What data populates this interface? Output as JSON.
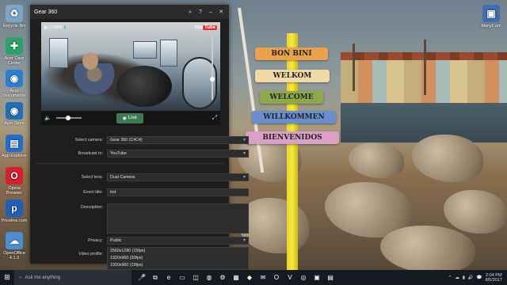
{
  "desktop": {
    "icons_left": [
      {
        "label": "Recycle Bin",
        "icon": "recycle-bin-icon",
        "color": "#7aa7c7",
        "glyph": "♻"
      },
      {
        "label": "Acer Care Center",
        "icon": "acer-care-center-icon",
        "color": "#2aa36a",
        "glyph": "✚"
      },
      {
        "label": "Acer Documents",
        "icon": "acer-documents-icon",
        "color": "#2a7fd0",
        "glyph": "◉"
      },
      {
        "label": "Acer Store",
        "icon": "acer-store-icon",
        "color": "#1e6fb8",
        "glyph": "◉"
      },
      {
        "label": "App Explorer",
        "icon": "app-explorer-icon",
        "color": "#1f6fd0",
        "glyph": "▤"
      },
      {
        "label": "Opera Browser",
        "icon": "opera-icon",
        "color": "#d6202e",
        "glyph": "O"
      },
      {
        "label": "Priceline.com",
        "icon": "priceline-icon",
        "color": "#1f5fb6",
        "glyph": "p"
      },
      {
        "label": "OpenOffice 4.1.3",
        "icon": "openoffice-icon",
        "color": "#4a8fd6",
        "glyph": "☁"
      }
    ],
    "icon_right": {
      "label": "ManyCam",
      "icon": "manycam-icon",
      "color": "#3e6fae",
      "glyph": "▣"
    },
    "signs": [
      "BON BINI",
      "WELKOM",
      "WELCOME",
      "WILLKOMMEN",
      "BIENVENIDOS"
    ]
  },
  "app": {
    "title": "Gear 360",
    "titlebar_buttons": [
      "●",
      "?",
      "–",
      "✕"
    ],
    "video": {
      "status_left": "100%",
      "youtube_label": "You",
      "youtube_badge": "Tube"
    },
    "controls": {
      "live_label": "Live",
      "volume_icon": "🔈",
      "fullscreen_icon": "⤢"
    },
    "form": {
      "camera_label": "Select camera:",
      "camera_value": "Gear 360 (C4C4)",
      "broadcast_label": "Broadcast to:",
      "broadcast_value": "YouTube",
      "lens_label": "Select lens:",
      "lens_value": "Dual Camera",
      "event_title_label": "Event title:",
      "event_title_value": "trst",
      "description_label": "Description:",
      "description_value": "",
      "privacy_label": "Privacy:",
      "privacy_value": "Public",
      "video_profile_label": "Video profile:",
      "video_profiles": [
        "2560x1280 (15fps)",
        "1920x960 (30fps)",
        "1920x960 (15fps)"
      ]
    }
  },
  "taskbar": {
    "search_placeholder": "Ask me anything",
    "apps": [
      {
        "icon": "microphone-icon",
        "glyph": "🎤"
      },
      {
        "icon": "task-view-icon",
        "glyph": "⧉"
      },
      {
        "icon": "edge-icon",
        "glyph": "e"
      },
      {
        "icon": "file-explorer-icon",
        "glyph": "▭"
      },
      {
        "icon": "store-icon",
        "glyph": "◫"
      },
      {
        "icon": "chrome-icon",
        "glyph": "◍"
      },
      {
        "icon": "settings-icon",
        "glyph": "⚙"
      },
      {
        "icon": "app-icon",
        "glyph": "▦"
      },
      {
        "icon": "dropbox-icon",
        "glyph": "◆"
      },
      {
        "icon": "mail-icon",
        "glyph": "✉"
      },
      {
        "icon": "opera-icon",
        "glyph": "O"
      },
      {
        "icon": "vivaldi-icon",
        "glyph": "V"
      },
      {
        "icon": "gear360-icon",
        "glyph": "◎"
      },
      {
        "icon": "app2-icon",
        "glyph": "▣"
      },
      {
        "icon": "notes-icon",
        "glyph": "▤"
      }
    ],
    "time": "2:04 PM",
    "date": "8/5/2017",
    "tray_icons": [
      "⌃",
      "☁",
      "▮",
      "🔊",
      "💬"
    ]
  }
}
